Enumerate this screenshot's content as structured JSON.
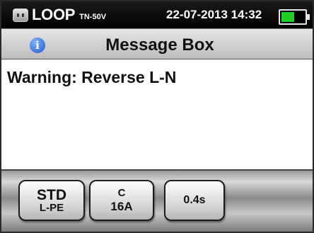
{
  "status_bar": {
    "mode": "LOOP",
    "mode_sub": "TN-50V",
    "datetime": "22-07-2013 14:32",
    "battery_level": 0.55,
    "battery_color": "#1fd11f"
  },
  "title_bar": {
    "icon": "info-icon",
    "title": "Message Box"
  },
  "message": "Warning: Reverse L-N",
  "softkeys": [
    {
      "line1": "STD",
      "line2": "L-PE"
    },
    {
      "line1": "C",
      "line2": "16A"
    },
    {
      "line1": "0.4s"
    }
  ]
}
